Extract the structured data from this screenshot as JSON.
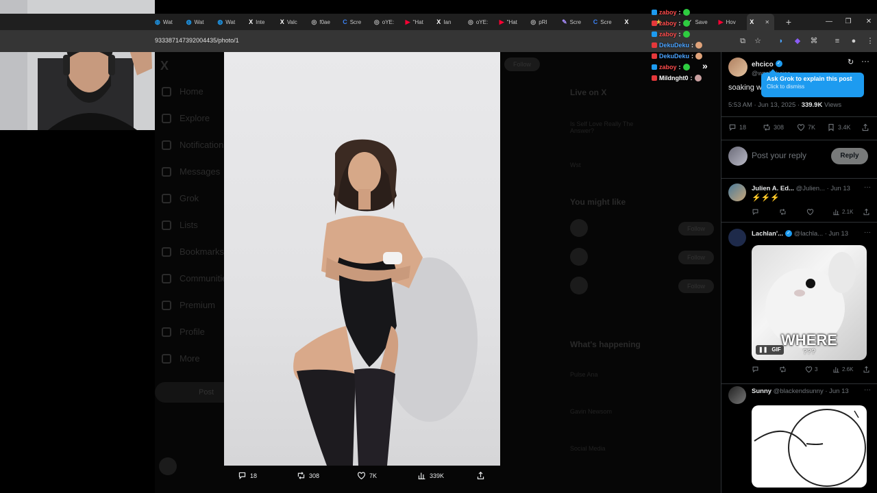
{
  "browser": {
    "tabs": [
      {
        "label": "Wat",
        "icon": "globe-icon",
        "color": "#1d9bf0"
      },
      {
        "label": "Wat",
        "icon": "globe-icon",
        "color": "#1d9bf0"
      },
      {
        "label": "Wat",
        "icon": "globe-icon",
        "color": "#1d9bf0"
      },
      {
        "label": "Inte",
        "icon": "x-logo-icon",
        "color": "#ffffff"
      },
      {
        "label": "Valc",
        "icon": "x-logo-icon",
        "color": "#ffffff"
      },
      {
        "label": "f0ae",
        "icon": "link-icon",
        "color": "#bbbbbb"
      },
      {
        "label": "Scre",
        "icon": "c-logo-icon",
        "color": "#3b82f6"
      },
      {
        "label": "oYE:",
        "icon": "link-icon",
        "color": "#bbbbbb"
      },
      {
        "label": "\"Hat",
        "icon": "youtube-icon",
        "color": "#ff0033"
      },
      {
        "label": "Ian",
        "icon": "x-logo-icon",
        "color": "#ffffff"
      },
      {
        "label": "oYE:",
        "icon": "link-icon",
        "color": "#bbbbbb"
      },
      {
        "label": "\"Hat",
        "icon": "youtube-icon",
        "color": "#ff0033"
      },
      {
        "label": "pRI",
        "icon": "link-icon",
        "color": "#bbbbbb"
      },
      {
        "label": "Scre",
        "icon": "pen-icon",
        "color": "#a78bfa"
      },
      {
        "label": "Scre",
        "icon": "c-logo-icon",
        "color": "#3b82f6"
      },
      {
        "label": "",
        "icon": "x-logo-icon",
        "color": "#ffffff"
      },
      {
        "label": "",
        "icon": "star-icon",
        "color": "#f5c542"
      },
      {
        "label": "Save",
        "icon": "check-icon",
        "color": "#bbbbbb"
      },
      {
        "label": "Hov",
        "icon": "youtube-icon",
        "color": "#ff0033"
      },
      {
        "label": "",
        "icon": "x-logo-icon",
        "color": "#ffffff",
        "active": true
      }
    ],
    "url": "933387147392004435/photo/1"
  },
  "chat": [
    {
      "user": "zaboy",
      "color": "#ff4d4d",
      "badge": "#1d9bf0",
      "emote": "green"
    },
    {
      "user": "zaboy",
      "color": "#ff4d4d",
      "badge": "#e5383b",
      "emote": "green"
    },
    {
      "user": "zaboy",
      "color": "#ff4d4d",
      "badge": "#1d9bf0",
      "emote": "green"
    },
    {
      "user": "DekuDeku",
      "color": "#4aa3ff",
      "badge": "#e5383b",
      "emote": "hand"
    },
    {
      "user": "DekuDeku",
      "color": "#4aa3ff",
      "badge": "#e5383b",
      "emote": "hand"
    },
    {
      "user": "zaboy",
      "color": "#ff4d4d",
      "badge": "#1d9bf0",
      "emote": "green"
    },
    {
      "user": "Mildnght0",
      "color": "#ffffff",
      "badge": "#e5383b",
      "emote": "face"
    }
  ],
  "dim_nav": [
    "Home",
    "Explore",
    "Notifications",
    "Messages",
    "Grok",
    "Lists",
    "Bookmarks",
    "Communities",
    "Premium",
    "Profile",
    "More"
  ],
  "dim_post_label": "Post",
  "dim_right": {
    "live_title": "Live on X",
    "might_like": "You might like",
    "happening": "What's happening",
    "follow": "Follow",
    "trends": [
      "Pulse Ana",
      "Gavin Newsom",
      "Social Media"
    ],
    "live_items": [
      "Is Self Love Really The Answer?",
      "Wst"
    ]
  },
  "photo_actions": {
    "replies": "18",
    "reposts": "308",
    "likes": "7K",
    "views": "339K"
  },
  "post": {
    "author_name": "ehcico",
    "author_handle": "@woahehcico",
    "text": "soaking w",
    "time": "5:53 AM · Jun 13, 2025 · ",
    "views_count": "339.9K",
    "views_label": " Views",
    "replies": "18",
    "reposts": "308",
    "likes": "7K",
    "bookmarks": "3.4K",
    "grok_title": "Ask Grok to explain this post",
    "grok_sub": "Click to dismiss",
    "reply_placeholder": "Post your reply",
    "reply_button": "Reply"
  },
  "replies": [
    {
      "name": "Julien A. Ed...",
      "handle": "@Julien... · Jun 13",
      "text": "⚡⚡⚡",
      "views": "2.1K",
      "likes": "",
      "reposts": "",
      "replies": ""
    },
    {
      "name": "Lachlan'...",
      "handle": "@lachla... · Jun 13",
      "verified": true,
      "gif_text": "WHERE",
      "gif_sub": "???",
      "gif_label": "GIF",
      "replies": "",
      "reposts": "",
      "likes": "3",
      "views": "2.6K"
    },
    {
      "name": "Sunny",
      "handle": "@blackendsunny · Jun 13"
    }
  ]
}
